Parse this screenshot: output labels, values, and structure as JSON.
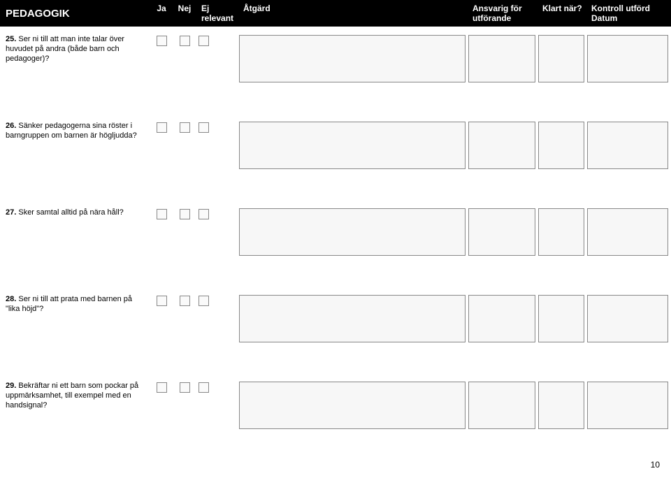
{
  "header": {
    "title": "PEDAGOGIK",
    "ja": "Ja",
    "nej": "Nej",
    "ej1": "Ej",
    "ej2": "relevant",
    "atgard": "Åtgärd",
    "ansvarig1": "Ansvarig för",
    "ansvarig2": "utförande",
    "klart": "Klart när?",
    "kontroll1": "Kontroll utförd",
    "kontroll2": "Datum"
  },
  "rows": [
    {
      "num": "25.",
      "text": " Ser ni till att man inte talar över huvu­det på andra (både barn och pedagoger)?"
    },
    {
      "num": "26.",
      "text": " Sänker pedagogerna sina röster i barngruppen om barnen är högljudda?"
    },
    {
      "num": "27.",
      "text": " Sker samtal alltid på nära håll?"
    },
    {
      "num": "28.",
      "text": " Ser ni till att prata med barnen på \"lika höjd\"?"
    },
    {
      "num": "29.",
      "text": " Bekräftar ni ett barn som pockar på uppmärksamhet, till exempel med en handsignal?"
    }
  ],
  "page_number": "10"
}
